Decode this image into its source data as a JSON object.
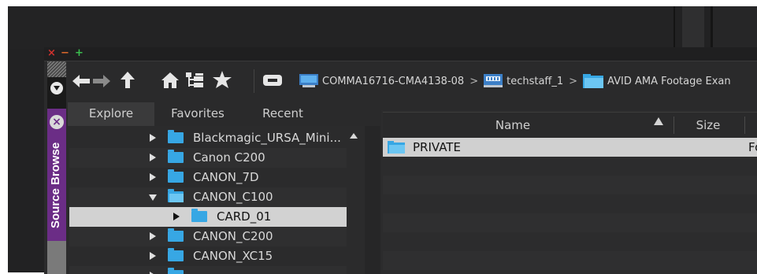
{
  "window": {
    "close_glyph": "×",
    "minimize_glyph": "−",
    "maximize_glyph": "+"
  },
  "source_browser": {
    "tab_title": "Source Browse",
    "close_glyph": "×"
  },
  "toolbar": {
    "icons": [
      "back-arrow-icon",
      "forward-arrow-icon",
      "up-arrow-icon",
      "home-icon",
      "tree-view-icon",
      "star-icon",
      "drive-icon"
    ],
    "breadcrumb": [
      {
        "label": "COMMA16716-CMA4138-08",
        "icon": "computer-icon"
      },
      {
        "label": "techstaff_1",
        "icon": "network-drive-icon"
      },
      {
        "label": "AVID AMA Footage Exan",
        "icon": "folder-icon"
      }
    ],
    "separator": ">"
  },
  "tabs": [
    {
      "label": "Explore",
      "active": true
    },
    {
      "label": "Favorites",
      "active": false
    },
    {
      "label": "Recent",
      "active": false
    }
  ],
  "tree": [
    {
      "label": "Blackmagic_URSA_Mini...",
      "expanded": false
    },
    {
      "label": "Canon C200",
      "expanded": false
    },
    {
      "label": "CANON_7D",
      "expanded": false
    },
    {
      "label": "CANON_C100",
      "expanded": true
    },
    {
      "label": "CARD_01",
      "expanded": false,
      "selected": true
    },
    {
      "label": "CANON_C200",
      "expanded": false
    },
    {
      "label": "CANON_XC15",
      "expanded": false
    }
  ],
  "file_list": {
    "columns": [
      "Name",
      "Size"
    ],
    "rows": [
      {
        "name": "PRIVATE",
        "kind": "Fo"
      }
    ]
  },
  "colors": {
    "accent_purple": "#6b2d86",
    "folder_blue": "#37a7e4",
    "selection": "#d2d2d2"
  }
}
